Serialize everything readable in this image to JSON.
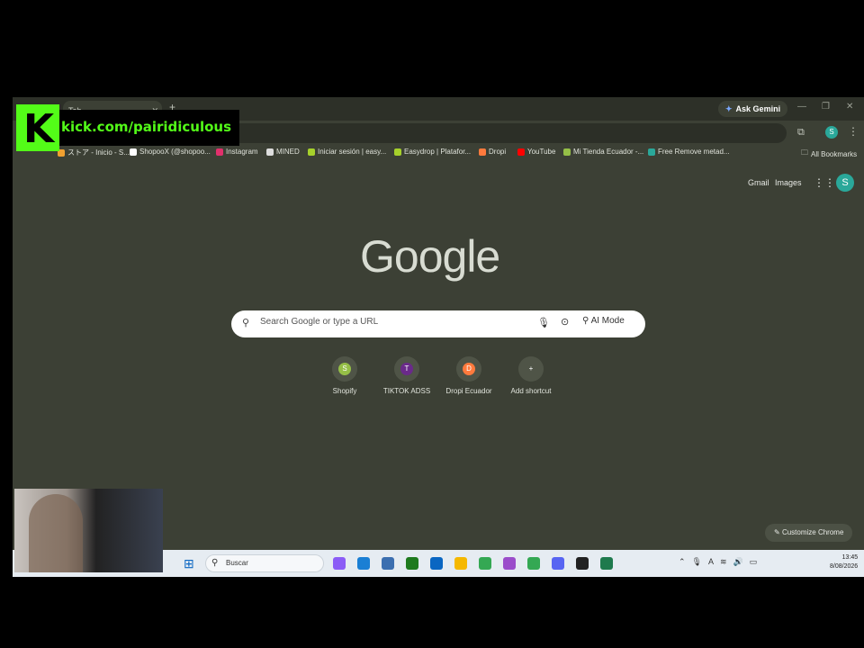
{
  "overlay": {
    "kick_url": "kick.com/pairidiculous"
  },
  "browser": {
    "tab_title": "Tab",
    "ask_gemini": "Ask Gemini",
    "profile_initial": "S",
    "bookmarks": [
      {
        "label": "ストア - Inicio - S...",
        "color": "#f0a030"
      },
      {
        "label": "ShopooX (@shopoo...",
        "color": "#ffffff"
      },
      {
        "label": "Instagram",
        "color": "#e1306c"
      },
      {
        "label": "MINED",
        "color": "#dddddd"
      },
      {
        "label": "Iniciar sesión | easy...",
        "color": "#a6d12b"
      },
      {
        "label": "Easydrop | Platafor...",
        "color": "#a6d12b"
      },
      {
        "label": "Dropi",
        "color": "#ff7a3d"
      },
      {
        "label": "YouTube",
        "color": "#ff0000"
      },
      {
        "label": "Mi Tienda Ecuador -...",
        "color": "#95bf47"
      },
      {
        "label": "Free Remove metad...",
        "color": "#2aa89a"
      }
    ],
    "all_bookmarks": "All Bookmarks"
  },
  "ntp": {
    "gmail": "Gmail",
    "images": "Images",
    "logo": "Google",
    "search_placeholder": "Search Google or type a URL",
    "ai_mode": "AI Mode",
    "shortcuts": [
      {
        "label": "Shopify",
        "icon": "S",
        "color": "#95bf47"
      },
      {
        "label": "TIKTOK ADSS",
        "icon": "T",
        "color": "#6a2a8a"
      },
      {
        "label": "Dropi Ecuador",
        "icon": "D",
        "color": "#ff7a3d"
      },
      {
        "label": "Add shortcut",
        "icon": "+",
        "color": "#4f5447"
      }
    ],
    "customize": "Customize Chrome"
  },
  "taskbar": {
    "search_label": "Buscar",
    "time": "13:45",
    "date": "8/08/2026",
    "apps": [
      "#8b5cf6",
      "#1a7fd4",
      "#3c6fb0",
      "#1e7a1e",
      "#0a66c2",
      "#f5b800",
      "#34a853",
      "#9b4dca",
      "#34a853",
      "#5865f2",
      "#222222",
      "#1f7a4d"
    ]
  }
}
